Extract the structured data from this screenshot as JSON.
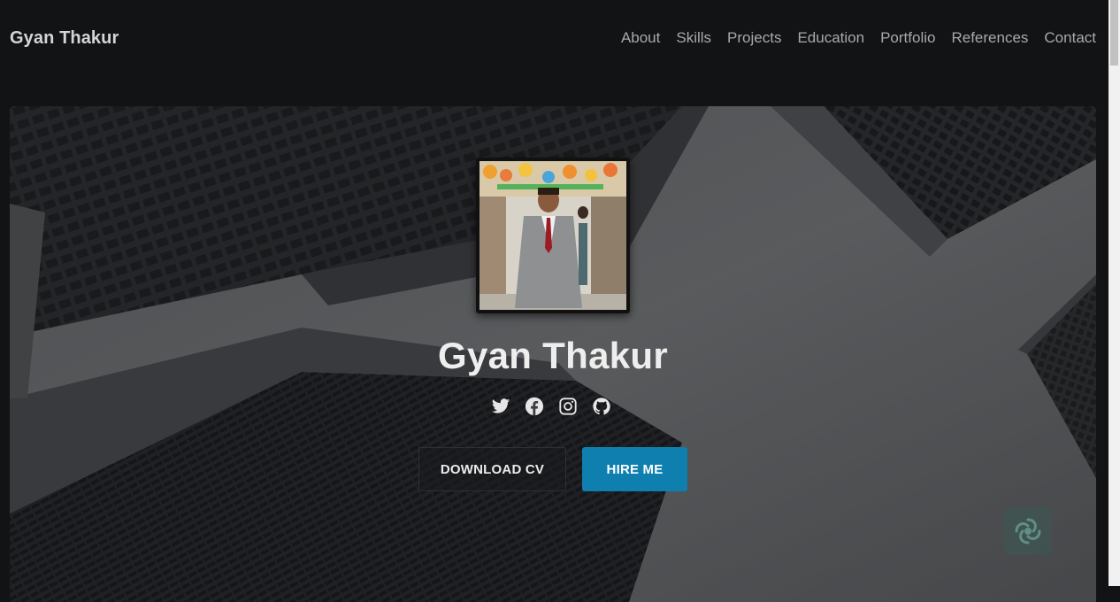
{
  "brand": "Gyan Thakur",
  "nav": {
    "items": [
      "About",
      "Skills",
      "Projects",
      "Education",
      "Portfolio",
      "References",
      "Contact"
    ]
  },
  "hero": {
    "name": "Gyan Thakur",
    "socials": [
      "twitter-icon",
      "facebook-icon",
      "instagram-icon",
      "github-icon"
    ],
    "download_label": "DOWNLOAD CV",
    "hire_label": "HIRE ME"
  },
  "colors": {
    "page_bg": "#121314",
    "accent": "#0f7faf",
    "nav_text": "#a7a9ab"
  }
}
